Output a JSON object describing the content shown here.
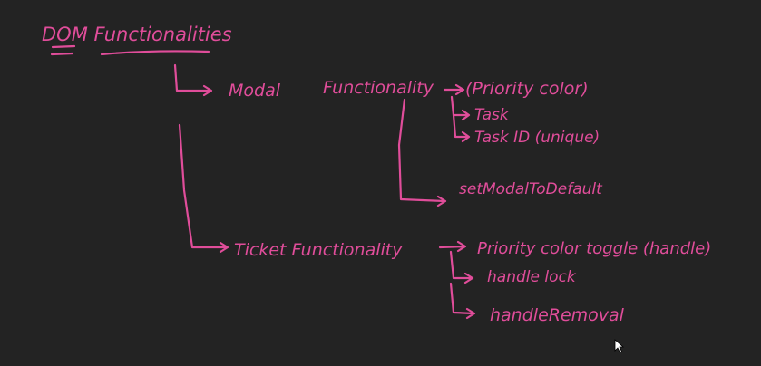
{
  "title": "DOM Functionalities",
  "colors": {
    "background": "#232323",
    "ink": "#e04d9a"
  },
  "modal": {
    "label": "Modal",
    "functionality_label": "Functionality",
    "items": {
      "priority_color": "(Priority color)",
      "task": "Task",
      "task_id": "Task ID (unique)",
      "set_modal_default": "setModalToDefault"
    }
  },
  "ticket": {
    "label": "Ticket Functionality",
    "items": {
      "priority_color_toggle": "Priority color toggle (handle)",
      "handle_lock": "handle lock",
      "handle_removal": "handleRemoval"
    }
  },
  "cursor_icon": "mouse-pointer-icon"
}
